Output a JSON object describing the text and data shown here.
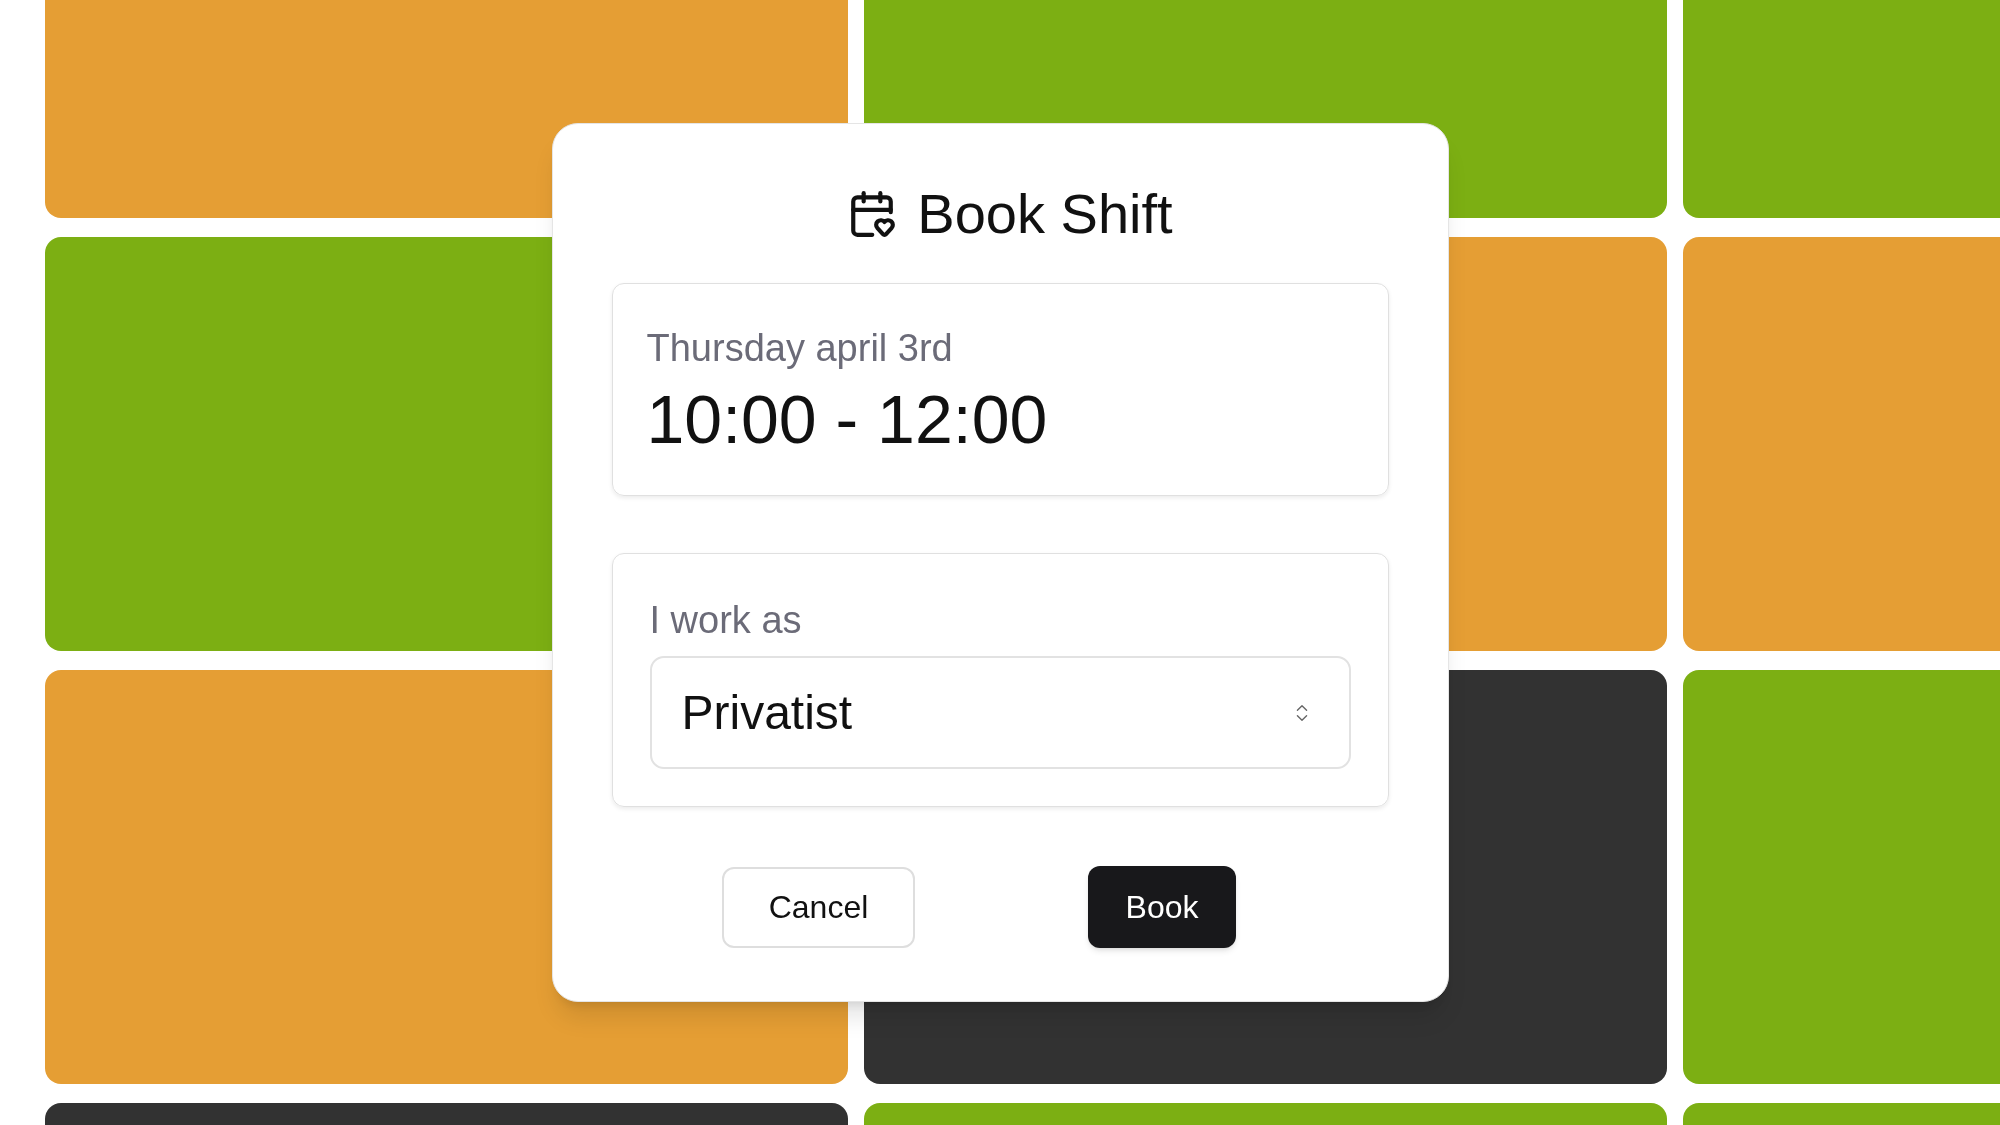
{
  "background": {
    "tiles": [
      {
        "color": "#e59e34"
      },
      {
        "color": "#7caf13"
      },
      {
        "color": "#7caf13"
      },
      {
        "color": "#7caf13"
      },
      {
        "color": "#e59e34"
      },
      {
        "color": "#e59e34"
      },
      {
        "color": "#e59e34"
      },
      {
        "color": "#323232"
      },
      {
        "color": "#7caf13"
      },
      {
        "color": "#323232"
      },
      {
        "color": "#7caf13"
      },
      {
        "color": "#7caf13"
      }
    ]
  },
  "dialog": {
    "title": "Book Shift",
    "shift": {
      "date": "Thursday april 3rd",
      "time": "10:00 - 12:00"
    },
    "role": {
      "label": "I work as",
      "value": "Privatist"
    },
    "buttons": [
      {
        "label": "Cancel",
        "kind": "secondary"
      },
      {
        "label": "Book",
        "kind": "primary"
      }
    ]
  }
}
